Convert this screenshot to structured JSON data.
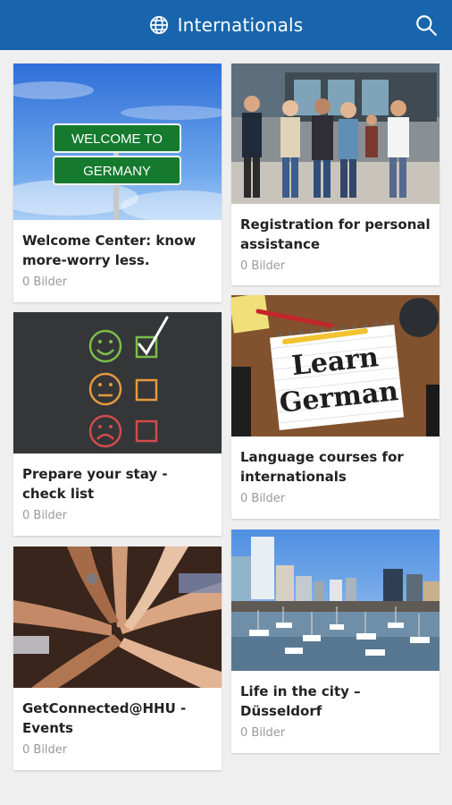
{
  "appbar": {
    "title": "Internationals",
    "bg": "#1865ad"
  },
  "cards": [
    {
      "title": "Welcome Center: know more-worry less.",
      "count": "0 Bilder",
      "sign_top": "WELCOME  TO",
      "sign_bottom": "GERMANY"
    },
    {
      "title": "Registration for personal assistance",
      "count": "0 Bilder"
    },
    {
      "title": "Prepare your stay - check list",
      "count": "0 Bilder"
    },
    {
      "title": "Language courses for internationals",
      "count": "0 Bilder",
      "note_line1": "Learn",
      "note_line2": "German"
    },
    {
      "title": "GetConnected@HHU - Events",
      "count": "0 Bilder"
    },
    {
      "title": "Life in the city – Düsseldorf",
      "count": "0 Bilder"
    }
  ]
}
